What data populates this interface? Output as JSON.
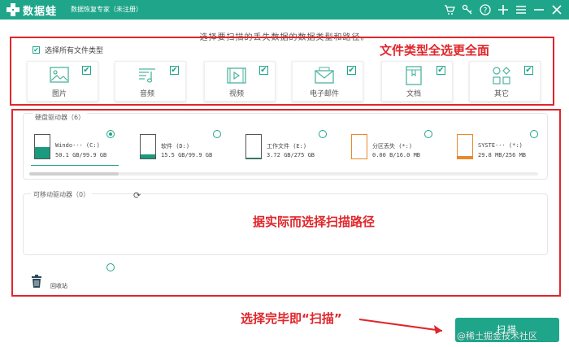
{
  "app": {
    "name": "数据蛙",
    "subtitle": "数据恢复专家（未注册）",
    "toolbar_icons": [
      "cart-icon",
      "key-icon",
      "help-icon",
      "plus-icon",
      "menu-icon",
      "minimize-icon",
      "close-icon"
    ]
  },
  "instruction": "选择要扫描的丢失数据的数据类型和路径。",
  "file_types": {
    "select_all_label": "选择所有文件类型",
    "select_all_checked": true,
    "items": [
      {
        "label": "图片",
        "icon": "image-icon",
        "checked": true
      },
      {
        "label": "音频",
        "icon": "music-icon",
        "checked": true
      },
      {
        "label": "视频",
        "icon": "video-icon",
        "checked": true
      },
      {
        "label": "电子邮件",
        "icon": "email-icon",
        "checked": true
      },
      {
        "label": "文档",
        "icon": "document-icon",
        "checked": true
      },
      {
        "label": "其它",
        "icon": "other-icon",
        "checked": true
      }
    ]
  },
  "hard_drives": {
    "label": "硬盘驱动器（6）",
    "items": [
      {
        "name": "Windo··· (C:)",
        "size": "50.1 GB/99.9 GB",
        "selected": true,
        "fill_color": "#1a9a7f",
        "border_color": "#555555",
        "used_fraction": 0.5
      },
      {
        "name": "软件 (D:)",
        "size": "15.5 GB/99.9 GB",
        "selected": false,
        "fill_color": "#1a9a7f",
        "border_color": "#555555",
        "used_fraction": 0.16
      },
      {
        "name": "工作文件 (E:)",
        "size": "3.72 GB/275 GB",
        "selected": false,
        "fill_color": "#1a9a7f",
        "border_color": "#555555",
        "used_fraction": 0.02
      },
      {
        "name": "分区丢失 (*:)",
        "size": "0.00  B/16.0 MB",
        "selected": false,
        "fill_color": "#e8892b",
        "border_color": "#e8892b",
        "used_fraction": 0.0
      },
      {
        "name": "SYSTE··· (*:)",
        "size": "29.8 MB/256 MB",
        "selected": false,
        "fill_color": "#e8892b",
        "border_color": "#e8892b",
        "used_fraction": 0.12
      }
    ]
  },
  "removable_drives": {
    "label": "可移动驱动器（0）"
  },
  "recycle_bin": {
    "label": "回收站",
    "selected": false
  },
  "scan_button": {
    "label": "扫描"
  },
  "annotations": {
    "file_types_note": "文件类型全选更全面",
    "path_note": "据实际而选择扫描路径",
    "scan_note": "选择完毕即“扫描”",
    "color": "#e0262b"
  },
  "watermark": "@稀土掘金技术社区"
}
